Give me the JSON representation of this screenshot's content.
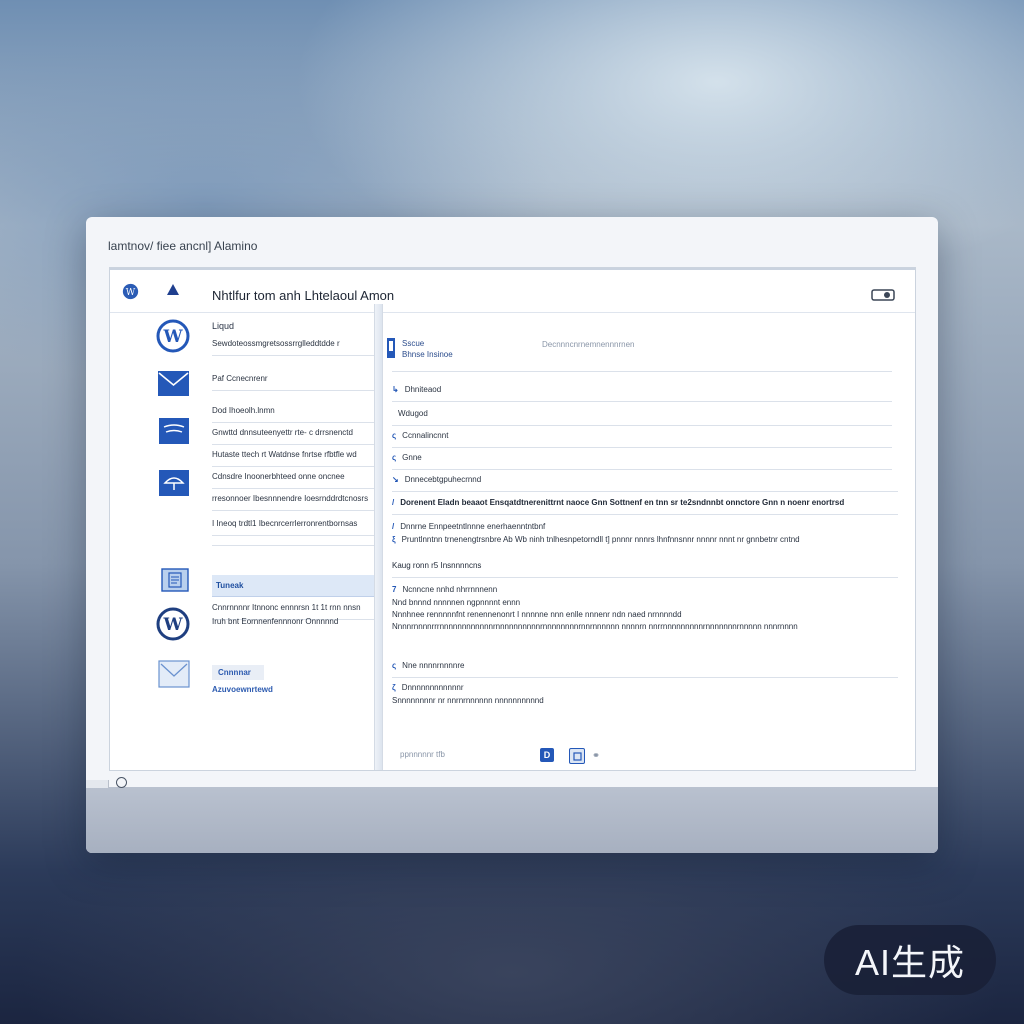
{
  "window": {
    "title": "lamtnov/ fiee ancnl] Alamino"
  },
  "topbar": {
    "title": "Nhtlfur tom anh Lhtelaoul Amon"
  },
  "sidebar_icons": [
    "wordpress-icon",
    "mail-icon",
    "screen-icon",
    "umbrella-icon",
    "document-icon",
    "wordpress-icon",
    "mail-icon"
  ],
  "left_list": {
    "items": [
      {
        "label": "Liqud"
      },
      {
        "label": "Sewdoteossmgretsossrrglleddtdde r"
      },
      {
        "label": "Paf Ccnecnrenr"
      },
      {
        "label": "Dod Ihoeolh.lnmn"
      },
      {
        "label": "Gnwttd dnnsuteenyettr rte- c drrsnenctd"
      },
      {
        "label": "Hutaste ttech rt Watdnse fnrtse rfbtfle wd"
      },
      {
        "label": "Cdnsdre Inoonerbhteed onne oncnee"
      },
      {
        "label": "rresonnoer Ibesnnnendre Ioesrnddrdtcnosrs"
      },
      {
        "label": "I Ineoq trdtl1 Ibecnrcerrlerronrentbornsas"
      }
    ],
    "selected": {
      "label": "Tuneak"
    },
    "sub_items": [
      {
        "label": "Cnnrnnnnr Itnnonc ennnrsn 1t 1t rnn nnsn"
      },
      {
        "label": "Iruh bnt Eornnenfennnonr Onnnnnd"
      }
    ],
    "bar_label": "Cnnnnar",
    "footer_label": "Azuvoewnrtewd"
  },
  "right_panel": {
    "header_line1": "Sscue",
    "header_line2": "Bhnse Insinoe",
    "header_aside": "Decnnncnrnemnennnrnen",
    "rows": [
      {
        "glyph": "↳",
        "text": "Dhniteaod"
      },
      {
        "glyph": "",
        "text": "Wdugod"
      },
      {
        "glyph": "ς",
        "text": "Ccnnalincnnt"
      },
      {
        "glyph": "ς",
        "text": "Gnne"
      },
      {
        "glyph": "↘",
        "text": "Dnnecebtgpuhecrnnd"
      },
      {
        "glyph": "/",
        "text": "Dorenent Eladn beaaot Ensqatdtnerenittrnt naoce Gnn Sottnenf en tnn sr te2sndnnbt onnctore Gnn n noenr enortrsd"
      },
      {
        "glyph": "/",
        "text": "Dnnrne Ennpeetntlnnne enerhaenntntbnf"
      },
      {
        "glyph": "ξ",
        "text": "Pruntlnntnn trnenengtrsnbre Ab Wb ninh tnlhesnpetorndll t] pnnnr nnnrs lhnfnnsnnr nnnnr nnnt nr gnnbetnr cntnd"
      }
    ],
    "section_title": "Kaug ronn r5 Insnnnncns",
    "sub_rows": [
      {
        "glyph": "7",
        "text": "Ncnncne nnhd nhrrnnnenn"
      },
      {
        "glyph": "",
        "text": "Nnd bnnnd nnnnnen ngpnnnnt ennn"
      },
      {
        "glyph": "",
        "text": "Nnnhnee rennnnnfnt renennenonrt I nnnnne nnn enlle nnnenr ndn naed nrnnnndd"
      },
      {
        "glyph": "",
        "text": "Nnnnrnnnnrrrnnnnnnnnnnnnrnnnnnnnnnnrnnnnnnnnrnnrnnnnnn nnnnrn nnrrnnnnnnnnnrnnnnnnnrnnnnn nnnrnnnn"
      }
    ],
    "footer_rows": [
      {
        "glyph": "ς",
        "text": "Nne nnnnrnnnnre"
      },
      {
        "glyph": "ζ",
        "text": "Dnnnnnnnnnnnnr"
      },
      {
        "glyph": "",
        "text": "Snnnnnnnnr nr nnrnrnnnnnn nnnnnnnnnnd"
      }
    ],
    "status_left": "ppnnnnnr tfb",
    "status_chip_label": "D"
  },
  "colors": {
    "accent": "#2256b5",
    "brand": "#1f4fa0",
    "badge_bg": "#1e263c"
  },
  "watermark": "AI生成"
}
